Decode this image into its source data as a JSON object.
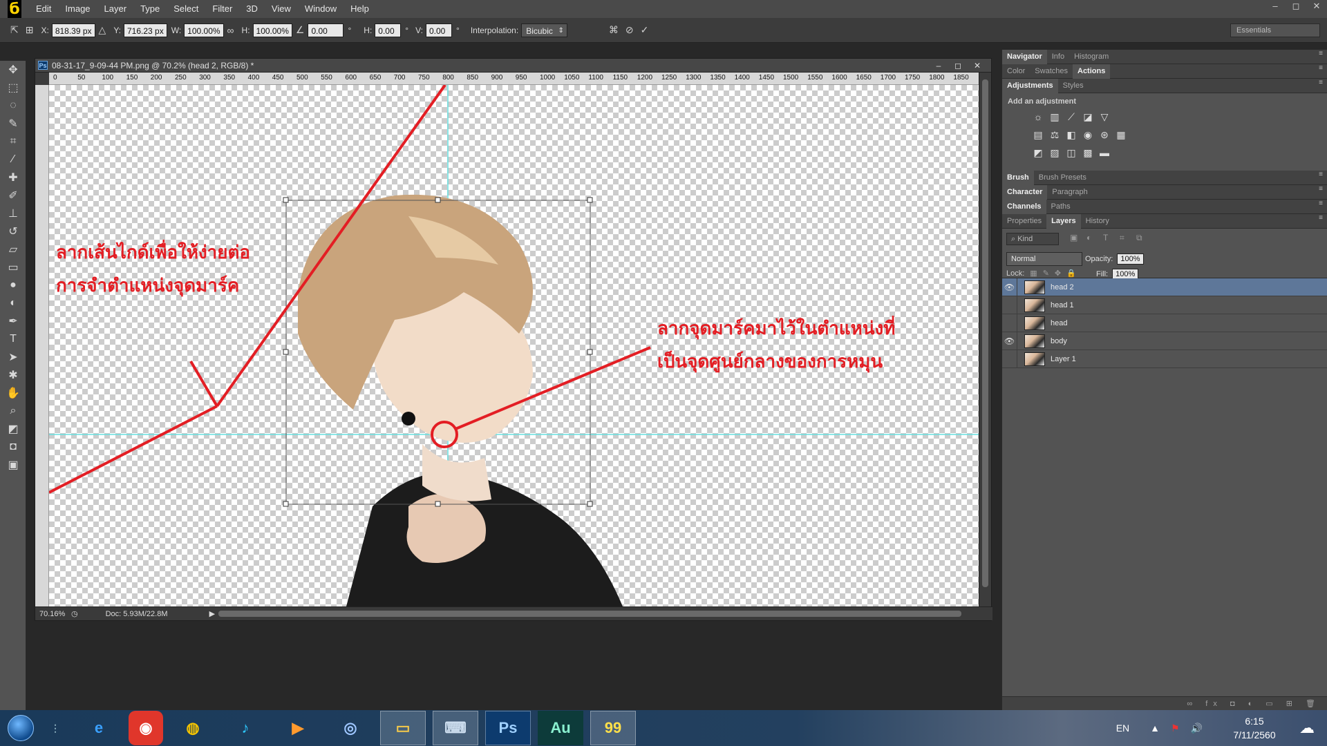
{
  "menubar": {
    "items": [
      "Edit",
      "Image",
      "Layer",
      "Type",
      "Select",
      "Filter",
      "3D",
      "View",
      "Window",
      "Help"
    ],
    "controls": [
      "–",
      "◻",
      "✕"
    ]
  },
  "options": {
    "x_label": "X:",
    "x_value": "818.39 px",
    "y_label": "Y:",
    "y_value": "716.23 px",
    "w_label": "W:",
    "w_value": "100.00%",
    "h_label": "H:",
    "h_value": "100.00%",
    "angle_value": "0.00",
    "angle_unit": "°",
    "hskew_label": "H:",
    "hskew_value": "0.00",
    "hskew_unit": "°",
    "vskew_label": "V:",
    "vskew_value": "0.00",
    "vskew_unit": "°",
    "interp_label": "Interpolation:",
    "interp_value": "Bicubic",
    "workspace": "Essentials"
  },
  "document": {
    "title": "08-31-17_9-09-44 PM.png @ 70.2% (head 2, RGB/8) *",
    "ps_badge": "Ps",
    "ruler_ticks": [
      "0",
      "50",
      "100",
      "150",
      "200",
      "250",
      "300",
      "350",
      "400",
      "450",
      "500",
      "550",
      "600",
      "650",
      "700",
      "750",
      "800",
      "850",
      "900",
      "950",
      "1000",
      "1050",
      "1100",
      "1150",
      "1200",
      "1250",
      "1300",
      "1350",
      "1400",
      "1450",
      "1500",
      "1550",
      "1600",
      "1650",
      "1700",
      "1750",
      "1800",
      "1850"
    ],
    "zoom": "70.16%",
    "doc_info": "Doc: 5.93M/22.8M"
  },
  "annotations": {
    "left_line1": "ลากเส้นไกด์เพื่อให้ง่ายต่อ",
    "left_line2": "การจำตำแหน่งจุดมาร์ค",
    "right_line1": "ลากจุดมาร์คมาไว้ในตำแหน่งที่",
    "right_line2": "เป็นจุดศูนย์กลางของการหมุน"
  },
  "panels": {
    "tabs_row1": [
      "Navigator",
      "Info",
      "Histogram"
    ],
    "tabs_row2": [
      "Color",
      "Swatches",
      "Actions"
    ],
    "tabs_row3": [
      "Adjustments",
      "Styles"
    ],
    "add_adjustment": "Add an adjustment",
    "tabs_brush": [
      "Brush",
      "Brush Presets"
    ],
    "tabs_char": [
      "Character",
      "Paragraph"
    ],
    "tabs_chan": [
      "Channels",
      "Paths"
    ],
    "tabs_layers": [
      "Properties",
      "Layers",
      "History"
    ],
    "kind": "Kind",
    "blend_mode": "Normal",
    "opacity_label": "Opacity:",
    "opacity_value": "100%",
    "lock_label": "Lock:",
    "fill_label": "Fill:",
    "fill_value": "100%"
  },
  "layers": [
    {
      "name": "head 2",
      "visible": true,
      "selected": true
    },
    {
      "name": "head 1",
      "visible": false,
      "selected": false
    },
    {
      "name": "head",
      "visible": false,
      "selected": false
    },
    {
      "name": "body",
      "visible": true,
      "selected": false
    },
    {
      "name": "Layer 1",
      "visible": false,
      "selected": false
    }
  ],
  "taskbar": {
    "lang": "EN",
    "time": "6:15",
    "date": "7/11/2560"
  },
  "colors": {
    "accent_red": "#e31e24",
    "guide": "#66e0e0",
    "selected_layer": "#5e7799"
  }
}
